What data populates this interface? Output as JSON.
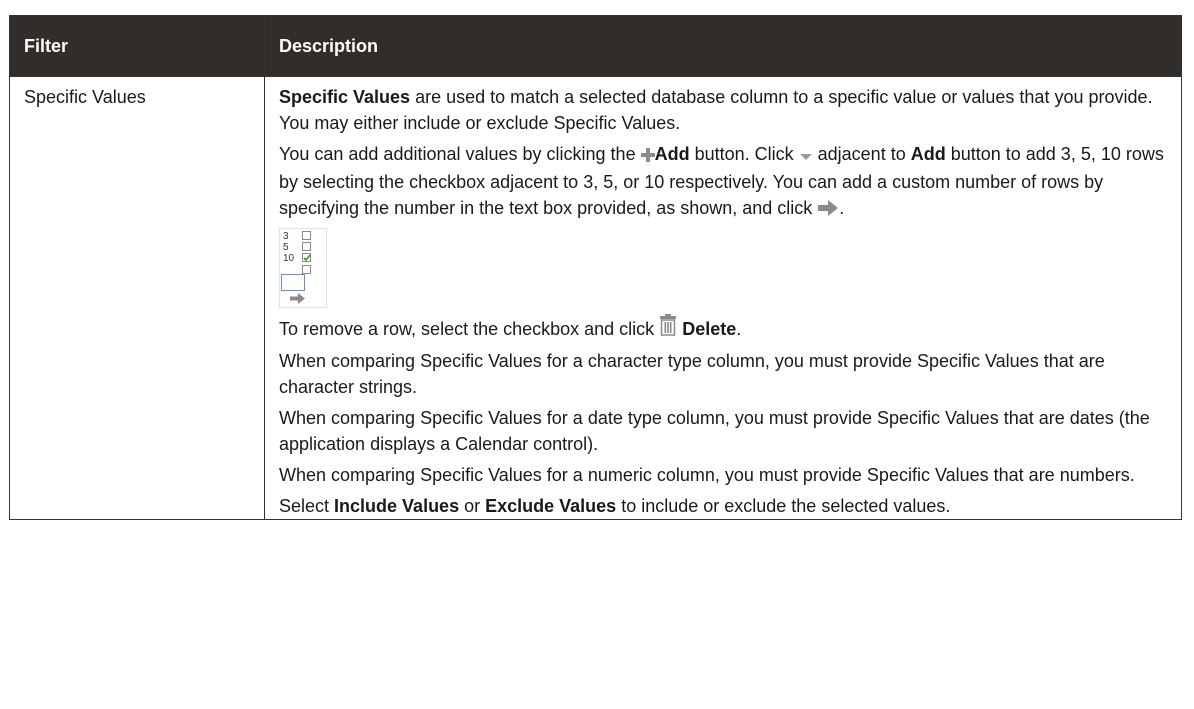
{
  "table": {
    "headers": [
      "Filter",
      "Description"
    ],
    "filter_name": "Specific Values",
    "p1": {
      "bold": "Specific Values",
      "rest": " are used to match a selected database column to a specific value or values that you provide. You may either include or exclude Specific Values."
    },
    "p2": {
      "t1": "You can add additional values by clicking the ",
      "add_label": "Add",
      "t2": " button. Click ",
      "t3": " adjacent to ",
      "add_label2": "Add",
      "t4": " button to add 3, 5, 10 rows by selecting the checkbox adjacent to 3, 5, or 10 respectively. You can add a custom number of rows by specifying the number in the text box provided, as shown, and click ",
      "t5": "."
    },
    "demo_rows": [
      "3",
      "5",
      "10"
    ],
    "p3": {
      "t1": "To remove a row, select the checkbox and click ",
      "delete_label": "Delete",
      "t2": "."
    },
    "p4": "When comparing Specific Values for a character type column, you must provide Specific Values that are character strings.",
    "p5": "When comparing Specific Values for a date type column, you must provide Specific Values that are dates (the application displays a Calendar control).",
    "p6": "When comparing Specific Values for a numeric column, you must provide Specific Values that are numbers.",
    "p7": {
      "t1": "Select ",
      "b1": "Include Values",
      "t2": " or ",
      "b2": "Exclude Values",
      "t3": " to include or exclude the selected values."
    }
  },
  "icons": {
    "add": "plus-icon",
    "dropdown": "dropdown-arrow-icon",
    "go": "right-arrow-icon",
    "delete": "trash-icon"
  },
  "colors": {
    "header_bg": "#312d2a",
    "icon_gray": "#8a8a8a",
    "check_green": "#3a9a3a"
  }
}
